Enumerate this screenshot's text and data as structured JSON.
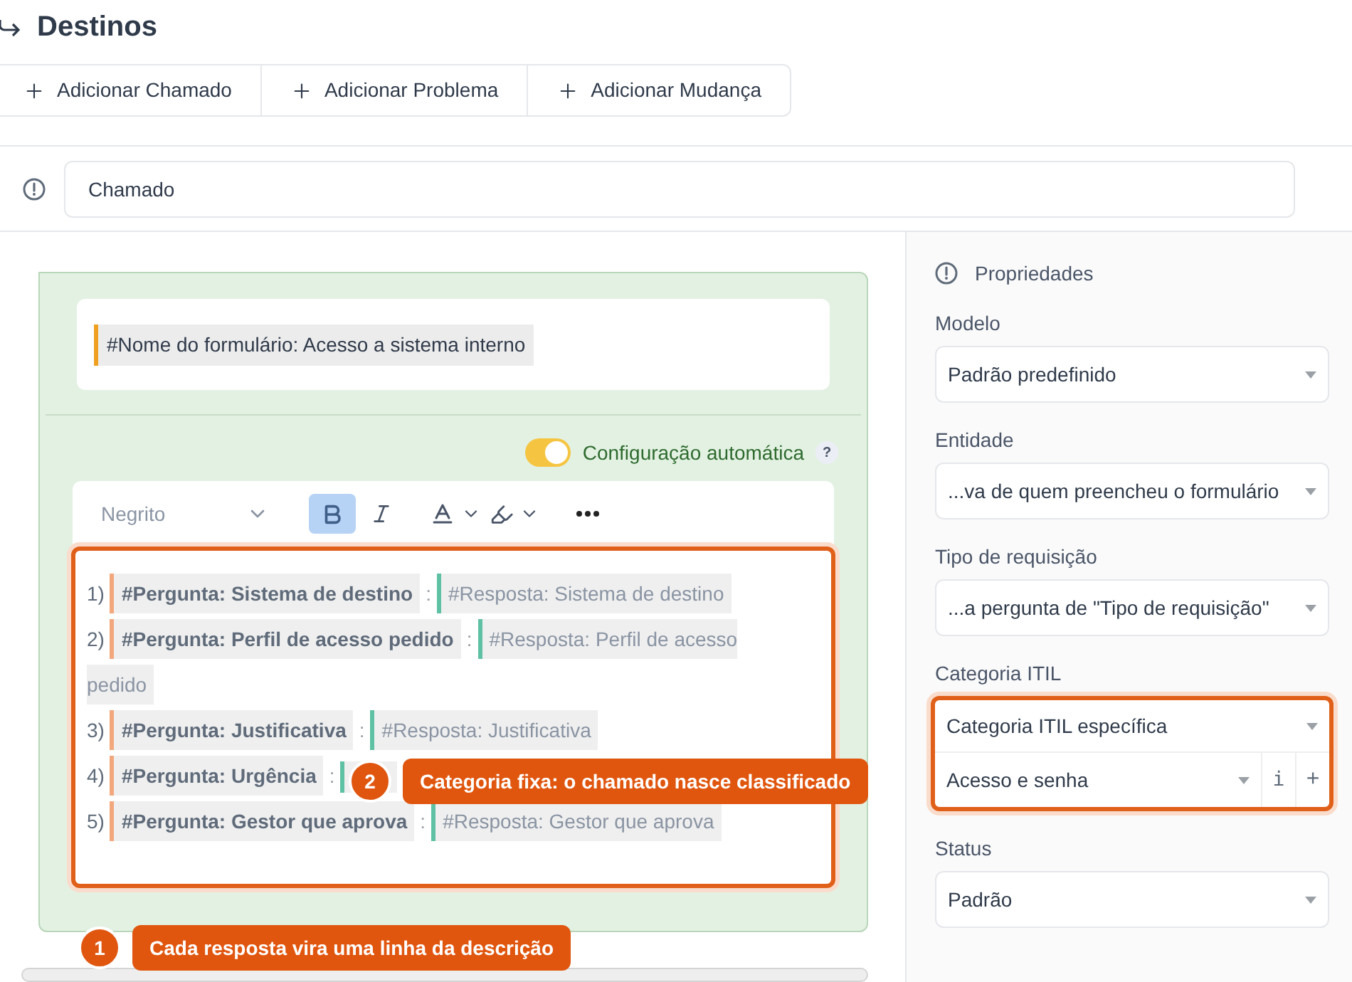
{
  "header": {
    "title": "Destinos"
  },
  "add_buttons": [
    "Adicionar Chamado",
    "Adicionar Problema",
    "Adicionar Mudança"
  ],
  "target_field": {
    "value": "Chamado"
  },
  "form_name": "#Nome do formulário: Acesso a sistema interno",
  "auto_config": {
    "label": "Configuração automática",
    "on": true,
    "help": "?"
  },
  "toolbar": {
    "style": "Negrito",
    "bold": true,
    "italic": false
  },
  "lines": [
    {
      "number": "1)",
      "question": "#Pergunta: Sistema de destino",
      "separator": ":",
      "answer": "#Resposta: Sistema de destino"
    },
    {
      "number": "2)",
      "question": "#Pergunta: Perfil de acesso pedido",
      "separator": ":",
      "answer": "#Resposta: Perfil de acesso pedido"
    },
    {
      "number": "3)",
      "question": "#Pergunta: Justificativa",
      "separator": ":",
      "answer": "#Resposta: Justificativa"
    },
    {
      "number": "4)",
      "question": "#Pergunta: Urgência",
      "separator": ":"
    },
    {
      "number": "5)",
      "question": "#Pergunta: Gestor que aprova",
      "separator": ":",
      "answer": "#Resposta: Gestor que aprova"
    }
  ],
  "properties": {
    "title": "Propriedades",
    "fields": [
      {
        "label": "Modelo",
        "value": "Padrão predefinido"
      },
      {
        "label": "Entidade",
        "value": "...va de quem preencheu o formulário"
      },
      {
        "label": "Tipo de requisição",
        "value": "...a pergunta de \"Tipo de requisição\""
      },
      {
        "label": "Categoria ITIL",
        "value": "Categoria ITIL específica",
        "sub_value": "Acesso e senha",
        "info": "i",
        "add": "+",
        "highlighted": true
      },
      {
        "label": "Status",
        "value": "Padrão"
      }
    ]
  },
  "callouts": [
    {
      "number": "2",
      "text": "Categoria fixa: o chamado nasce classificado"
    },
    {
      "number": "1",
      "text": "Cada resposta vira uma linha da descrição"
    }
  ]
}
